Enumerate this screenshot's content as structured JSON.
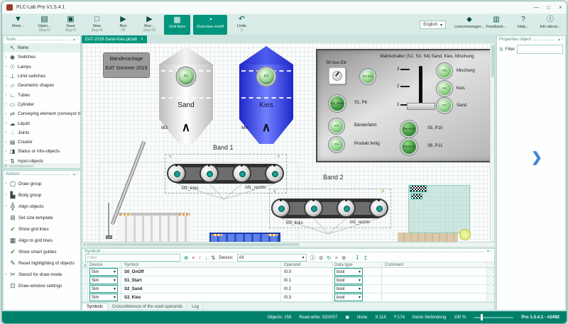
{
  "window": {
    "title": "PLC-Lab Pro V1.5.4.1",
    "minimize": "—",
    "maximize": "□",
    "close": "×"
  },
  "toolbar": {
    "buttons": [
      {
        "label": "More...",
        "shortcut": "",
        "icon": "▼"
      },
      {
        "label": "Open...",
        "shortcut": "Strg+O",
        "icon": "▤"
      },
      {
        "label": "Save",
        "shortcut": "Strg+S",
        "icon": "▣"
      },
      {
        "label": "New",
        "shortcut": "Strg+N",
        "icon": "□"
      },
      {
        "label": "Run",
        "shortcut": "F5",
        "icon": "▶"
      },
      {
        "label": "Run...",
        "shortcut": "Strg+F5",
        "icon": "▶"
      },
      {
        "label": "Grid lines",
        "shortcut": "",
        "icon": "▦"
      },
      {
        "label": "Overview on/off",
        "shortcut": "",
        "icon": "◔"
      },
      {
        "label": "Undo",
        "shortcut": "Z",
        "icon": "↶"
      }
    ],
    "language": "English",
    "dropdown_arrow": "▾",
    "right_buttons": [
      {
        "label": "Lizenzmanager...",
        "icon": "◆"
      },
      {
        "label": "Feedback...",
        "icon": "▥"
      },
      {
        "label": "Help...",
        "icon": "?"
      },
      {
        "label": "Info about...",
        "icon": "ⓘ"
      }
    ]
  },
  "tools_panel": {
    "title": "Tools",
    "collapse_icon": "▾",
    "pin_icon": "▫",
    "scroll_arrow": "◂",
    "items": [
      {
        "pre": "",
        "icon": "↖",
        "label": "None"
      },
      {
        "pre": "»",
        "icon": "◉",
        "label": "Switches"
      },
      {
        "pre": "»",
        "icon": "☉",
        "label": "Lamps"
      },
      {
        "pre": "»",
        "icon": "⊥",
        "label": "Limit switches"
      },
      {
        "pre": "»",
        "icon": "▱",
        "label": "Geometric shapes"
      },
      {
        "pre": "»",
        "icon": "∟",
        "label": "Tubes"
      },
      {
        "pre": "»",
        "icon": "▭",
        "label": "Cylinder"
      },
      {
        "pre": "»",
        "icon": "⇄",
        "label": "Conveying element (conveyor belt, air cur"
      },
      {
        "pre": "»",
        "icon": "☁",
        "label": "Liquid"
      },
      {
        "pre": "»",
        "icon": "∴",
        "label": "Joints"
      },
      {
        "pre": "»",
        "icon": "▤",
        "label": "Creator"
      },
      {
        "pre": "»",
        "icon": "◨",
        "label": "Status or info-objects"
      },
      {
        "pre": "»",
        "icon": "⇅",
        "label": "Input-objects"
      }
    ]
  },
  "actions_panel": {
    "title": "Actions",
    "collapse_icon": "▾",
    "pin_icon": "▫",
    "items": [
      {
        "pre": "»",
        "icon": "▢",
        "label": "Draw group"
      },
      {
        "pre": "»",
        "icon": "▙",
        "label": "Body group"
      },
      {
        "pre": "»",
        "icon": "╬",
        "label": "Align objects"
      },
      {
        "pre": "",
        "icon": "⊞",
        "label": "Set size-template"
      },
      {
        "pre": "",
        "icon": "✔",
        "label": "Show grid lines"
      },
      {
        "pre": "",
        "icon": "▦",
        "label": "Align to grid lines"
      },
      {
        "pre": "",
        "icon": "✔",
        "label": "Show smart guides"
      },
      {
        "pre": "",
        "icon": "✎",
        "label": "Reset highlighting of objects"
      },
      {
        "pre": "»",
        "icon": "✂",
        "label": "Stencil for draw-mode"
      },
      {
        "pre": "",
        "icon": "⊡",
        "label": "Draw-window settings"
      }
    ]
  },
  "tabbar": {
    "active_tab": "EAT-2019-Sand-Kies.plclab",
    "close": "×"
  },
  "canvas": {
    "info_box": {
      "line1": "Bänderanlage",
      "line2": "EAT Sommer 2019"
    },
    "silo_sand": {
      "label": "Sand",
      "button": "P1",
      "motor": "M3",
      "arrow": "∧"
    },
    "silo_kies": {
      "label": "Kies",
      "button": "P2",
      "motor": "M4",
      "arrow": "∧"
    },
    "control_panel": {
      "title": "Wahlschalter (S2, S3, S4) Sand, Kies, Mischung",
      "s0_label": "S0  Aus    Ein",
      "p5ein_btn": "P5 Ein",
      "s1_btn": "S1_Start",
      "s1_label": "S1, P6",
      "p3_btn": "P3",
      "p3_label": "Bänderfahrt",
      "p4_btn": "P4",
      "p4_label": "Produkt fertig",
      "tick3": "3",
      "tick2": "2",
      "tick1": "1",
      "p5_btn": "P5",
      "p5_label": "Mischung",
      "p6_btn": "P6",
      "p6_label": "Kies",
      "p7_btn": "P7",
      "p7_label": "Sand",
      "res1_btn": "Reserve",
      "res1_label": "S5, P10",
      "res2_btn": "Reserve",
      "res2_label": "S6, P11"
    },
    "band1": {
      "title": "Band 1",
      "left": "M1_links",
      "right": "M1_rechts",
      "chev_left": "<",
      "chev_right": ">"
    },
    "band2": {
      "title": "Band 2",
      "left": "M2_links",
      "right": "M2_rechts",
      "chev_left": "<",
      "chev_right": ">"
    }
  },
  "symbols_panel": {
    "title": "Symbols",
    "collapse_icon": "▾",
    "pin_icon": "▫",
    "filter_placeholder": "Filter:",
    "toolbar_icons": {
      "add": "⊕",
      "delete": "×",
      "up": "↑",
      "down": "↓",
      "sort": "⇅",
      "info": "ⓘ",
      "watch": "⊚",
      "refresh": "↻",
      "remove": "×",
      "settings": "⊛",
      "import": "↧",
      "export": "↥"
    },
    "device_label": "Device:",
    "device_value": "All",
    "select_arrow": "▾",
    "corner_sort": "◢",
    "columns": {
      "device": "Device",
      "symbol": "Symbol",
      "operand": "Operand",
      "datatype": "Data type",
      "comment": "Comment"
    },
    "rows": [
      {
        "device": "Sim",
        "symbol": "S0_OnOff",
        "operand": "I0.0",
        "datatype": "bool",
        "comment": ""
      },
      {
        "device": "Sim",
        "symbol": "S1_Start",
        "operand": "I0.1",
        "datatype": "bool",
        "comment": ""
      },
      {
        "device": "Sim",
        "symbol": "S2_Sand",
        "operand": "I0.2",
        "datatype": "bool",
        "comment": ""
      },
      {
        "device": "Sim",
        "symbol": "S3_Kies",
        "operand": "I0.3",
        "datatype": "bool",
        "comment": ""
      }
    ],
    "tabs": [
      "Symbols",
      "Crossreference of the used operands",
      "Log"
    ]
  },
  "properties_panel": {
    "title": "Properties object",
    "collapse_icon": "▾",
    "pin_icon": "▫",
    "sort_icon": "⇅",
    "filter_label": "Filter",
    "expander": "❯"
  },
  "status_bar": {
    "objects": "Objects: 159",
    "read_write": "Read-write: 020/007",
    "device_icon": "▣",
    "none_label": "None",
    "x": "X:114",
    "y": "Y:174",
    "connection": "Keine Verbindung",
    "zoom": "100 %",
    "version": "Pro 1.5.4.1 - #2492"
  }
}
